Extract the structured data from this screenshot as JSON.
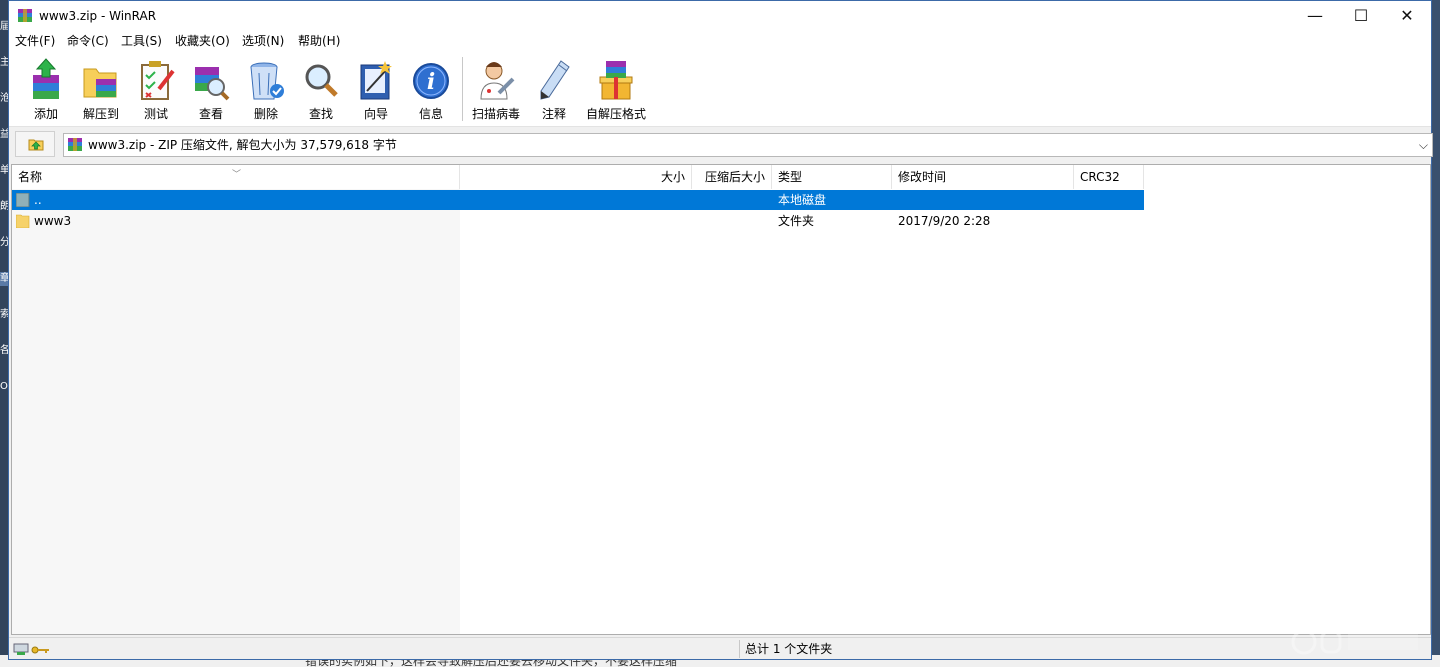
{
  "background": {
    "left_glyphs": [
      "届",
      "主",
      "沧",
      "益",
      "单",
      "朗",
      "分",
      "章",
      "索",
      "各",
      "O"
    ],
    "bottom_text": "错误的实例如下，这样会导致解压后还要去移动文件夹，不要这样压缩"
  },
  "window": {
    "title": "www3.zip - WinRAR",
    "minimize_glyph": "—",
    "maximize_glyph": "☐",
    "close_glyph": "✕"
  },
  "menu": [
    "文件(F)",
    "命令(C)",
    "工具(S)",
    "收藏夹(O)",
    "选项(N)",
    "帮助(H)"
  ],
  "toolbar": [
    {
      "label": "添加",
      "icon": "add-icon"
    },
    {
      "label": "解压到",
      "icon": "extract-to-icon"
    },
    {
      "label": "测试",
      "icon": "test-icon"
    },
    {
      "label": "查看",
      "icon": "view-icon"
    },
    {
      "label": "删除",
      "icon": "delete-icon"
    },
    {
      "label": "查找",
      "icon": "find-icon"
    },
    {
      "label": "向导",
      "icon": "wizard-icon"
    },
    {
      "label": "信息",
      "icon": "info-icon"
    },
    {
      "label": "扫描病毒",
      "icon": "virus-scan-icon"
    },
    {
      "label": "注释",
      "icon": "comment-icon"
    },
    {
      "label": "自解压格式",
      "icon": "sfx-icon"
    }
  ],
  "address": {
    "text": "www3.zip - ZIP 压缩文件, 解包大小为 37,579,618 字节",
    "dropdown_glyph": "⌵"
  },
  "columns": [
    "名称",
    "大小",
    "压缩后大小",
    "类型",
    "修改时间",
    "CRC32"
  ],
  "rows": [
    {
      "name": "..",
      "size": "",
      "packed": "",
      "type": "本地磁盘",
      "modified": "",
      "crc": "",
      "selected": true
    },
    {
      "name": "www3",
      "size": "",
      "packed": "",
      "type": "文件夹",
      "modified": "2017/9/20 2:28",
      "crc": "",
      "selected": false
    }
  ],
  "status": {
    "text": "总计 1 个文件夹"
  },
  "colors": {
    "selection": "#0078d7",
    "folder": "#f6d26a",
    "window_border": "#3c6aa8"
  }
}
